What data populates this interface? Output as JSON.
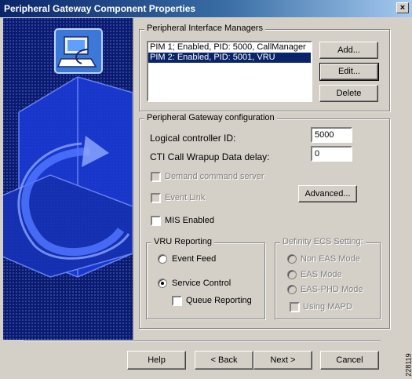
{
  "window": {
    "title": "Peripheral Gateway Component Properties",
    "close_glyph": "×"
  },
  "pim_group": {
    "label": "Peripheral Interface Managers",
    "items": [
      {
        "text": "PIM 1; Enabled, PID: 5000, CallManager",
        "selected": false
      },
      {
        "text": "PIM 2: Enabled, PID: 5001, VRU",
        "selected": true
      }
    ],
    "add_label": "Add...",
    "edit_label": "Edit...",
    "delete_label": "Delete"
  },
  "pg_config": {
    "label": "Peripheral Gateway configuration",
    "logical_controller_label": "Logical controller ID:",
    "logical_controller_value": "5000",
    "cti_wrapup_label": "CTI Call Wrapup Data delay:",
    "cti_wrapup_value": "0",
    "demand_command_label": "Demand command server",
    "event_link_label": "Event Link",
    "advanced_label": "Advanced...",
    "mis_enabled_label": "MIS Enabled",
    "mis_enabled_checked": false
  },
  "vru_reporting": {
    "label": "VRU Reporting",
    "event_feed_label": "Event Feed",
    "service_control_label": "Service Control",
    "selected": "service_control",
    "queue_reporting_label": "Queue Reporting",
    "queue_reporting_checked": false
  },
  "definity": {
    "label": "Definity ECS Setting:",
    "non_eas_label": "Non EAS Mode",
    "eas_label": "EAS Mode",
    "eas_phd_label": "EAS-PHD Mode",
    "using_mapd_label": "Using MAPD"
  },
  "footer": {
    "help_label": "Help",
    "back_label": "< Back",
    "next_label": "Next >",
    "cancel_label": "Cancel"
  },
  "figure_id": "228119",
  "colors": {
    "title_start": "#0a246a",
    "title_end": "#a6caf0",
    "dialog_bg": "#d4d0c8",
    "art_bg": "#0a1a6e",
    "selection": "#0a246a"
  }
}
